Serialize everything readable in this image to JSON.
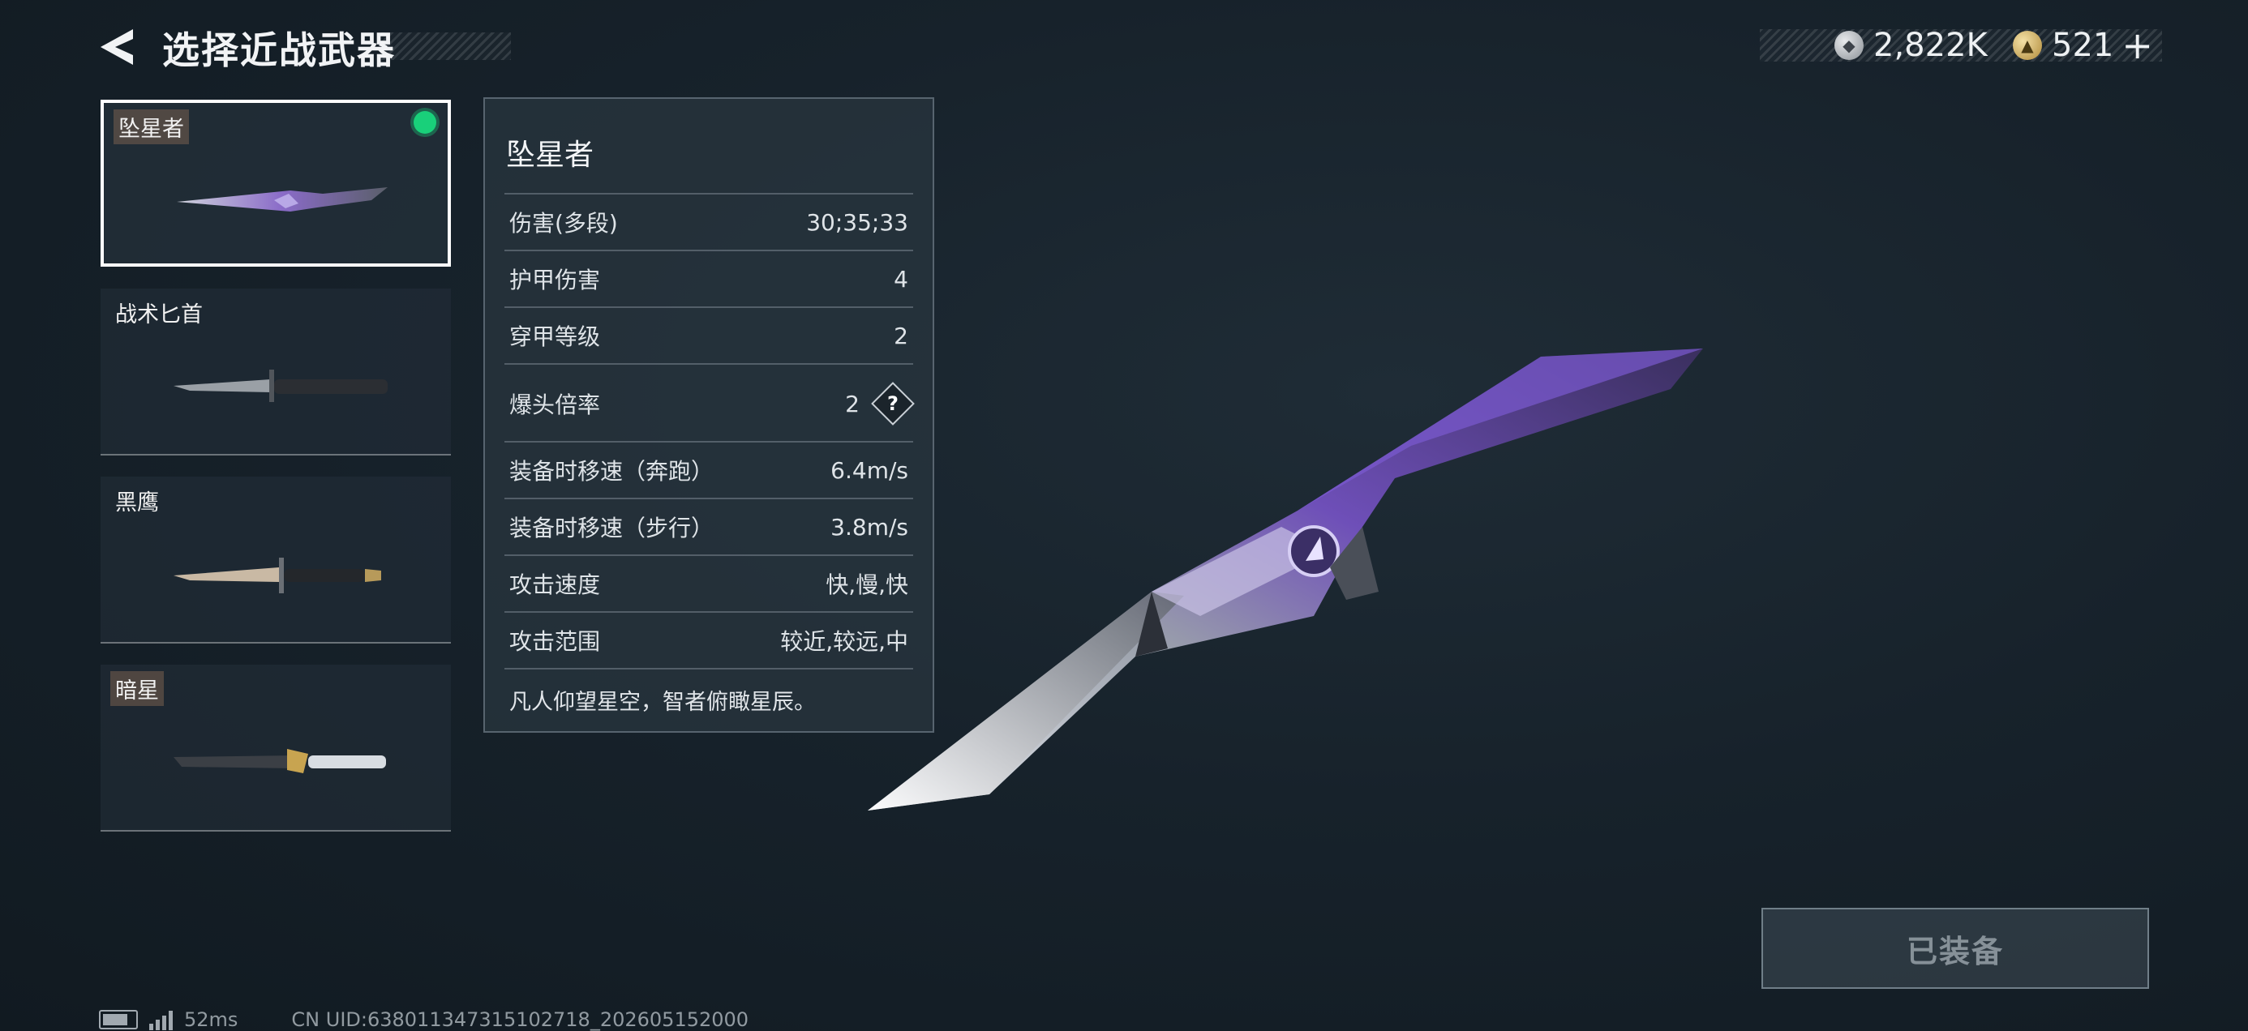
{
  "header": {
    "title": "选择近战武器",
    "currencies": [
      {
        "icon": "silver-coin-icon",
        "value": "2,822K"
      },
      {
        "icon": "gold-coin-icon",
        "value": "521",
        "add": "+"
      }
    ]
  },
  "weapons": [
    {
      "name": "坠星者",
      "selected": true,
      "equipped": true
    },
    {
      "name": "战术匕首",
      "selected": false,
      "equipped": false
    },
    {
      "name": "黑鹰",
      "selected": false,
      "equipped": false
    },
    {
      "name": "暗星",
      "selected": false,
      "equipped": false
    }
  ],
  "stats": {
    "title": "坠星者",
    "rows": [
      {
        "label": "伤害(多段)",
        "value": "30;35;33"
      },
      {
        "label": "护甲伤害",
        "value": "4"
      },
      {
        "label": "穿甲等级",
        "value": "2"
      },
      {
        "label": "爆头倍率",
        "value": "2",
        "help": "?"
      },
      {
        "label": "装备时移速（奔跑）",
        "value": "6.4m/s"
      },
      {
        "label": "装备时移速（步行）",
        "value": "3.8m/s"
      },
      {
        "label": "攻击速度",
        "value": "快,慢,快"
      },
      {
        "label": "攻击范围",
        "value": "较近,较远,中"
      }
    ],
    "description": "凡人仰望星空，智者俯瞰星辰。"
  },
  "equip_button": {
    "label": "已装备"
  },
  "footer": {
    "ping": "52ms",
    "uid": "CN UID:638011347315102718_202605152000"
  },
  "colors": {
    "equipped_indicator": "#19d07a",
    "accent_purple": "#8a5cd6",
    "background": "#17222b"
  }
}
